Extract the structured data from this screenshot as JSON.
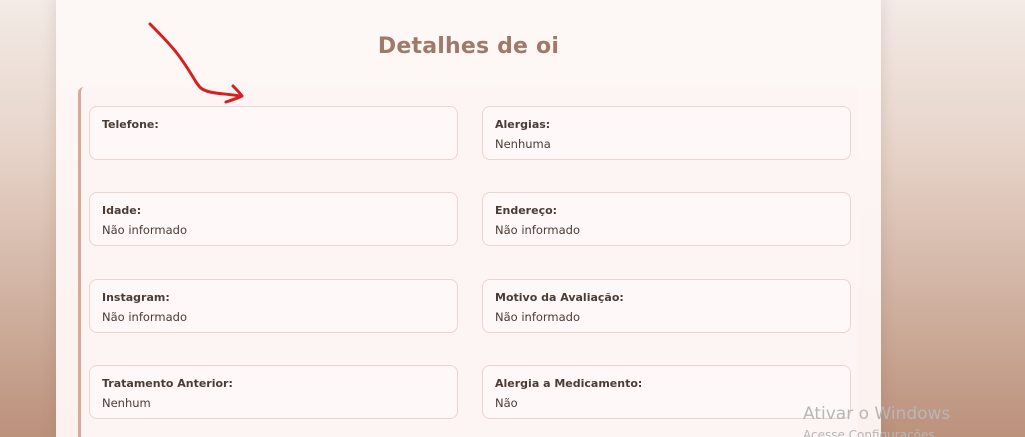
{
  "page": {
    "title": "Detalhes de oi"
  },
  "fields": [
    {
      "label": "Telefone:",
      "value": ""
    },
    {
      "label": "Alergias:",
      "value": "Nenhuma"
    },
    {
      "label": "Idade:",
      "value": "Não informado"
    },
    {
      "label": "Endereço:",
      "value": "Não informado"
    },
    {
      "label": "Instagram:",
      "value": "Não informado"
    },
    {
      "label": "Motivo da Avaliação:",
      "value": "Não informado"
    },
    {
      "label": "Tratamento Anterior:",
      "value": "Nenhum"
    },
    {
      "label": "Alergia a Medicamento:",
      "value": "Não"
    }
  ],
  "annotation": {
    "icon": "hand-drawn-arrow-icon",
    "color": "#d42020"
  },
  "watermark": {
    "line1": "Ativar o Windows",
    "line2": "Acesse Configurações"
  },
  "colors": {
    "title": "#a07a66",
    "accent_border": "#d7a99d",
    "card_border": "#ecd4d0"
  }
}
